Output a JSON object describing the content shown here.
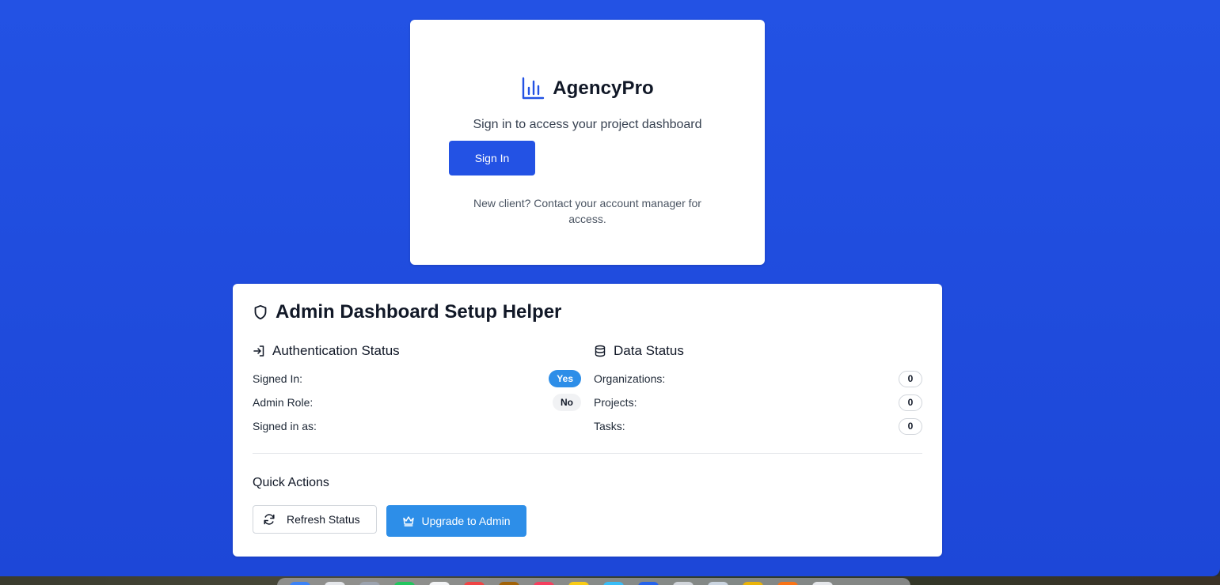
{
  "brand": {
    "name": "AgencyPro",
    "icon": "bar-chart-icon",
    "color": "#2352e4"
  },
  "signin": {
    "subtitle": "Sign in to access your project dashboard",
    "button_label": "Sign In",
    "note": "New client? Contact your account manager for access."
  },
  "admin_helper": {
    "title": "Admin Dashboard Setup Helper",
    "title_icon": "shield-icon",
    "auth": {
      "heading": "Authentication Status",
      "icon": "sign-in-icon",
      "rows": [
        {
          "label": "Signed In:",
          "value": "Yes"
        },
        {
          "label": "Admin Role:",
          "value": "No"
        },
        {
          "label": "Signed in as:",
          "value": ""
        }
      ]
    },
    "data": {
      "heading": "Data Status",
      "icon": "database-icon",
      "rows": [
        {
          "label": "Organizations:",
          "value": "0"
        },
        {
          "label": "Projects:",
          "value": "0"
        },
        {
          "label": "Tasks:",
          "value": "0"
        }
      ]
    },
    "quick_actions": {
      "heading": "Quick Actions",
      "refresh_label": "Refresh Status",
      "refresh_icon": "refresh-icon",
      "upgrade_label": "Upgrade to Admin",
      "upgrade_icon": "crown-icon"
    }
  },
  "colors": {
    "background": "#2352e4",
    "primary_button": "#2352e4",
    "accent_button": "#2d8ee8",
    "card": "#ffffff"
  }
}
